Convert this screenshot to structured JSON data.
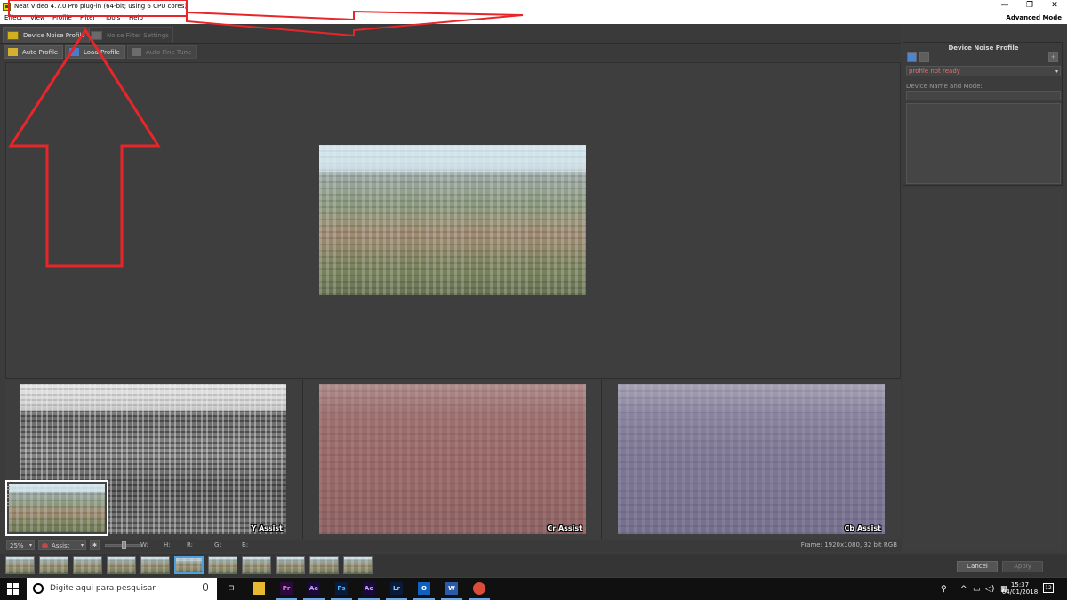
{
  "window": {
    "title": "Neat Video 4.7.0  Pro plug-in (64-bit; using 6 CPU cores)",
    "mode_label": "Advanced Mode",
    "controls": {
      "minimize": "—",
      "restore": "❐",
      "close": "✕"
    }
  },
  "menu": {
    "items": [
      "Effect",
      "View",
      "Profile",
      "Filter",
      "Tools",
      "Help"
    ]
  },
  "tabs": [
    {
      "label": "Device Noise Profile",
      "active": true
    },
    {
      "label": "Noise Filter Settings",
      "active": false
    }
  ],
  "toolbar": {
    "auto_profile": "Auto Profile",
    "load_profile": "Load Profile",
    "auto_fine_tune": "Auto Fine Tune"
  },
  "assist": {
    "y_label": "Y Assist",
    "cr_label": "Cr Assist",
    "cb_label": "Cb Assist"
  },
  "statusbar": {
    "zoom": "25%",
    "assist_mode": "Assist",
    "star_icon": "✱",
    "dropdown_arrow": "▾",
    "w_label": "W:",
    "h_label": "H:",
    "r_label": "R:",
    "g_label": "G:",
    "b_label": "B:",
    "frame_info": "Frame: 1920x1080, 32 bit RGB",
    "slider_position": 0.5
  },
  "filmstrip": {
    "count": 11,
    "selected_index": 5
  },
  "dialog": {
    "cancel": "Cancel",
    "apply": "Apply"
  },
  "right_panel": {
    "title": "Device Noise Profile",
    "profile_status": "profile not ready",
    "device_name_label": "Device Name and Mode:",
    "add_icon": "+",
    "status_color": "#e07070"
  },
  "taskbar": {
    "search_placeholder": "Digite aqui para pesquisar",
    "apps": [
      {
        "name": "task-view",
        "label": "❐",
        "color": "#ffffff",
        "bg": "transparent"
      },
      {
        "name": "file-explorer",
        "label": "",
        "color": "#f0c040",
        "bg": "#e8b830"
      },
      {
        "name": "premiere",
        "label": "Pr",
        "color": "#e878e8",
        "bg": "#2a0a3a"
      },
      {
        "name": "after-effects",
        "label": "Ae",
        "color": "#c8a0ff",
        "bg": "#1a0a3a"
      },
      {
        "name": "photoshop",
        "label": "Ps",
        "color": "#48b8f8",
        "bg": "#0a1a3a"
      },
      {
        "name": "after-effects-2",
        "label": "Ae",
        "color": "#c8a0ff",
        "bg": "#1a0a3a"
      },
      {
        "name": "lightroom",
        "label": "Lr",
        "color": "#8ac8f8",
        "bg": "#0a1a3a"
      },
      {
        "name": "outlook",
        "label": "O",
        "color": "#ffffff",
        "bg": "#1060c0"
      },
      {
        "name": "word",
        "label": "W",
        "color": "#ffffff",
        "bg": "#2a5aa8"
      },
      {
        "name": "chrome",
        "label": "",
        "color": "#ffffff",
        "bg": "#dd4b39"
      }
    ],
    "time": "15:37",
    "date": "04/01/2018",
    "tray_icons": [
      "⚲",
      "^",
      "▭",
      "◁)",
      "▦"
    ],
    "notifications": "12"
  },
  "colors": {
    "annotation_red": "#e8262a",
    "selected_thumb": "#4ca0e0"
  }
}
